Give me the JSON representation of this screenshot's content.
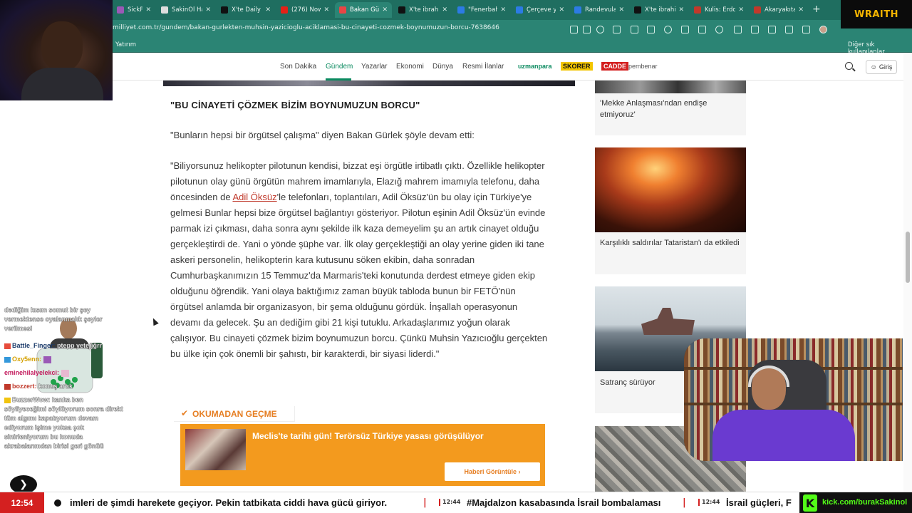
{
  "browser": {
    "tabs": [
      {
        "label": "SickPeek - R",
        "favicon_color": "#9b59b6"
      },
      {
        "label": "SakinOl Hab",
        "favicon_color": "#dddddd"
      },
      {
        "label": "X'te Daily Tu",
        "favicon_color": "#111111"
      },
      {
        "label": "(276) Now T",
        "favicon_color": "#e62117"
      },
      {
        "label": "Bakan Gürle",
        "favicon_color": "#e84545",
        "active": true
      },
      {
        "label": "X'te ibrahim",
        "favicon_color": "#111111"
      },
      {
        "label": "\"Fenerbahçe",
        "favicon_color": "#2c7be5"
      },
      {
        "label": "Çerçeve yası",
        "favicon_color": "#2c7be5"
      },
      {
        "label": "Randevular",
        "favicon_color": "#2c7be5"
      },
      {
        "label": "X'te ibrahim",
        "favicon_color": "#111111"
      },
      {
        "label": "Kulis: Erdoğ",
        "favicon_color": "#c0392b"
      },
      {
        "label": "Akaryakıta ç",
        "favicon_color": "#c0392b"
      }
    ],
    "url": "milliyet.com.tr/gundem/bakan-gurlekten-muhsin-yazicioglu-aciklamasi-bu-cinayeti-cozmek-boynumuzun-borcu-7638646",
    "bookmark_left": "Yatırım",
    "bookmark_right": "Diğer sık kullanılanlar"
  },
  "site_nav": {
    "links": [
      "Son Dakika",
      "Gündem",
      "Yazarlar",
      "Ekonomi",
      "Dünya",
      "Resmi İlanlar"
    ],
    "active": "Gündem",
    "brands": [
      "uzmanpara",
      "SKORER",
      "CADDE",
      "pembenar"
    ],
    "login_label": "Giriş"
  },
  "article": {
    "heading": "\"BU CİNAYETİ ÇÖZMEK BİZİM BOYNUMUZUN BORCU\"",
    "intro": "\"Bunların hepsi bir örgütsel çalışma\" diyen Bakan Gürlek şöyle devam etti:",
    "quote_before_link": "\"Biliyorsunuz helikopter pilotunun kendisi, bizzat eşi örgütle irtibatlı çıktı. Özellikle helikopter pilotunun olay günü örgütün mahrem imamlarıyla, Elazığ mahrem imamıyla telefonu, daha öncesinden de ",
    "quote_link": "Adil Öksüz",
    "quote_after_link": "'le telefonları, toplantıları, Adil Öksüz'ün bu olay için Türkiye'ye gelmesi Bunlar hepsi bize örgütsel bağlantıyı gösteriyor. Pilotun eşinin Adil Öksüz'ün evinde parmak izi çıkması, daha sonra aynı şekilde ilk kaza demeyelim şu an artık cinayet olduğu gerçekleştirdi de. Yani o yönde şüphe var. İlk olay gerçekleştiği an olay yerine giden iki tane askeri personelin, helikopterin kara kutusunu söken ekibin, daha sonradan Cumhurbaşkanımızın 15 Temmuz'da Marmaris'teki konutunda derdest etmeye giden ekip olduğunu öğrendik. Yani olaya baktığımız zaman büyük tabloda bunun bir FETÖ'nün örgütsel anlamda bir organizasyon, bir şema olduğunu gördük. İnşallah operasyonun devamı da gelecek. Şu an dediğim gibi 21 kişi tutuklu. Arkadaşlarımız yoğun olarak çalışıyor. Bu cinayeti çözmek bizim boynumuzun borcu. Çünkü Muhsin Yazıcıoğlu gerçekten bu ülke için çok önemli bir şahıstı, bir karakterdi, bir siyasi liderdi.\""
  },
  "related": {
    "label": "OKUMADAN GEÇME",
    "promo_title": "Meclis'te tarihi gün! Terörsüz Türkiye yasası görüşülüyor",
    "promo_button": "Haberi Görüntüle ›"
  },
  "sidebar": {
    "cards": [
      {
        "title": "'Mekke Anlaşması'ndan endişe etmiyoruz'"
      },
      {
        "title": "Karşılıklı saldırılar Tataristan'ı da etkiledi"
      },
      {
        "title": "Satranç sürüyor"
      },
      {
        "title": ""
      }
    ]
  },
  "chat": {
    "messages": [
      {
        "user": "",
        "text": "dediğim kısım somut bir şey vermektense oyalanmalık şeyler verilmesi"
      },
      {
        "user": "Battle_Finger:",
        "text": "ptepp yeteğğrr"
      },
      {
        "user": "Oxy5enn:",
        "text": ""
      },
      {
        "user": "eminehilalyelekci:",
        "text": ""
      },
      {
        "user": "bozzert:",
        "text": "konuş artık"
      },
      {
        "user": "BuzzerWow:",
        "text": "kanka ben söyliyeceğimi söylüyorum sonra direkt tüm algımı kapatıyorum devam ediyorum işime yoksa çok sinirleniyorum bu konuda akrabalarımdan birisi geri gönüü"
      }
    ]
  },
  "overlay": {
    "brand": "WRAITH",
    "clock": "12:54",
    "ticker": [
      {
        "time": "",
        "text": "imleri de şimdi harekete geçiyor. Pekin tatbikata ciddi hava gücü giriyor."
      },
      {
        "time": "12:44",
        "text": "#Majdalzon kasabasında İsrail bombalaması"
      },
      {
        "time": "12:44",
        "text": "İsrail güçleri, F"
      }
    ],
    "kick_url": "kick.com/burakSakinol"
  }
}
